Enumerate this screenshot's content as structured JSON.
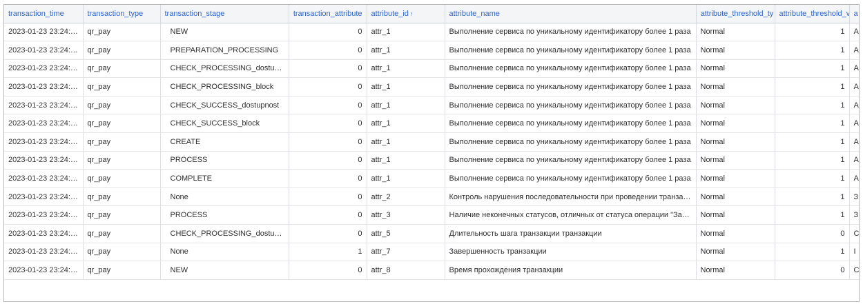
{
  "table": {
    "columns": [
      {
        "label": "transaction_time",
        "align": "left"
      },
      {
        "label": "transaction_type",
        "align": "left"
      },
      {
        "label": "transaction_stage",
        "align": "left"
      },
      {
        "label": "transaction_attribute",
        "align": "right"
      },
      {
        "label": "attribute_id",
        "align": "left",
        "sort": "asc"
      },
      {
        "label": "attribute_name",
        "align": "left"
      },
      {
        "label": "attribute_threshold_ty",
        "align": "left"
      },
      {
        "label": "attribute_threshold_v",
        "align": "right"
      },
      {
        "label": "a",
        "align": "left"
      }
    ],
    "rows": [
      [
        "2023-01-23 23:24:1…",
        "qr_pay",
        "NEW",
        "0",
        "attr_1",
        "Выполнение сервиса по уникальному идентификатору более 1 раза",
        "Normal",
        "1",
        "A"
      ],
      [
        "2023-01-23 23:24:1…",
        "qr_pay",
        "PREPARATION_PROCESSING",
        "0",
        "attr_1",
        "Выполнение сервиса по уникальному идентификатору более 1 раза",
        "Normal",
        "1",
        "A"
      ],
      [
        "2023-01-23 23:24:1…",
        "qr_pay",
        "CHECK_PROCESSING_dostupnost",
        "0",
        "attr_1",
        "Выполнение сервиса по уникальному идентификатору более 1 раза",
        "Normal",
        "1",
        "A"
      ],
      [
        "2023-01-23 23:24:1…",
        "qr_pay",
        "CHECK_PROCESSING_block",
        "0",
        "attr_1",
        "Выполнение сервиса по уникальному идентификатору более 1 раза",
        "Normal",
        "1",
        "A"
      ],
      [
        "2023-01-23 23:24:1…",
        "qr_pay",
        "CHECK_SUCCESS_dostupnost",
        "0",
        "attr_1",
        "Выполнение сервиса по уникальному идентификатору более 1 раза",
        "Normal",
        "1",
        "A"
      ],
      [
        "2023-01-23 23:24:1…",
        "qr_pay",
        "CHECK_SUCCESS_block",
        "0",
        "attr_1",
        "Выполнение сервиса по уникальному идентификатору более 1 раза",
        "Normal",
        "1",
        "A"
      ],
      [
        "2023-01-23 23:24:1…",
        "qr_pay",
        "CREATE",
        "0",
        "attr_1",
        "Выполнение сервиса по уникальному идентификатору более 1 раза",
        "Normal",
        "1",
        "A"
      ],
      [
        "2023-01-23 23:24:1…",
        "qr_pay",
        "PROCESS",
        "0",
        "attr_1",
        "Выполнение сервиса по уникальному идентификатору более 1 раза",
        "Normal",
        "1",
        "A"
      ],
      [
        "2023-01-23 23:24:1…",
        "qr_pay",
        "COMPLETE",
        "0",
        "attr_1",
        "Выполнение сервиса по уникальному идентификатору более 1 раза",
        "Normal",
        "1",
        "A"
      ],
      [
        "2023-01-23 23:24:1…",
        "qr_pay",
        "None",
        "0",
        "attr_2",
        "Контроль нарушения последовательности при проведении транзакции",
        "Normal",
        "1",
        "З"
      ],
      [
        "2023-01-23 23:24:1…",
        "qr_pay",
        "PROCESS",
        "0",
        "attr_3",
        "Наличие неконечных статусов, отличных от статуса операции \"Завершено\"",
        "Normal",
        "1",
        "З"
      ],
      [
        "2023-01-23 23:24:1…",
        "qr_pay",
        "CHECK_PROCESSING_dostupnost",
        "0",
        "attr_5",
        "Длительность шага транзакции транзакции",
        "Normal",
        "0",
        "C"
      ],
      [
        "2023-01-23 23:24:1…",
        "qr_pay",
        "None",
        "1",
        "attr_7",
        "Завершенность транзакции",
        "Normal",
        "1",
        "I"
      ],
      [
        "2023-01-23 23:24:1…",
        "qr_pay",
        "NEW",
        "0",
        "attr_8",
        "Время прохождения транзакции",
        "Normal",
        "0",
        "C"
      ]
    ]
  },
  "sort_icon": "arrow-up-icon",
  "colors": {
    "header_text": "#2f65cb",
    "header_bg": "#f4f5f7"
  }
}
